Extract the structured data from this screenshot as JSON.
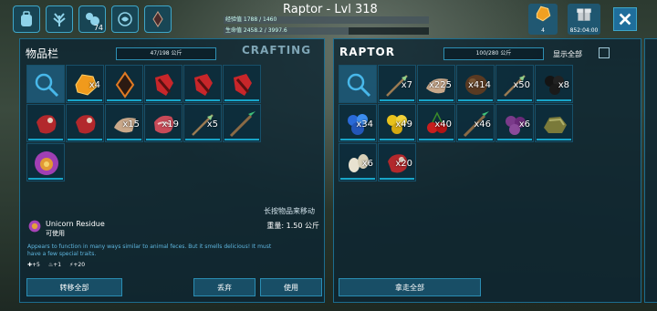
{
  "creature": {
    "title": "Raptor - Lvl 318",
    "xp_bar": "经验值 1788 / 1460",
    "xp_fill": 1.0,
    "hp_bar": "生命值 2458.2 / 3997.6",
    "hp_fill": 0.61
  },
  "top_icons": [
    {
      "name": "backpack-icon"
    },
    {
      "name": "engram-icon"
    },
    {
      "name": "tribe-icon",
      "count": "74"
    },
    {
      "name": "map-icon"
    },
    {
      "name": "crystal-icon"
    }
  ],
  "currency": {
    "amber_count": "4",
    "gift_timer": "852:04:00"
  },
  "colors": {
    "accent": "#1f6e9c",
    "quality_blue": "#18a4c8",
    "desc_text": "#5fb7e0"
  },
  "inventory": {
    "title": "物品栏",
    "weight": "47/198 公斤",
    "crafting_tab": "CRAFTING",
    "slots": [
      {
        "icon": "search-icon",
        "qty": ""
      },
      {
        "icon": "amber-icon",
        "qty": "x4"
      },
      {
        "icon": "element-crystal-icon",
        "qty": ""
      },
      {
        "icon": "red-shard-icon",
        "qty": ""
      },
      {
        "icon": "red-shard-icon",
        "qty": ""
      },
      {
        "icon": "red-shard-icon",
        "qty": ""
      },
      {
        "icon": "raw-meat-icon",
        "qty": ""
      },
      {
        "icon": "raw-meat-icon",
        "qty": ""
      },
      {
        "icon": "hide-icon",
        "qty": "x15"
      },
      {
        "icon": "prime-meat-icon",
        "qty": "x19"
      },
      {
        "icon": "arrow-icon",
        "qty": "x5"
      },
      {
        "icon": "spear-icon",
        "qty": ""
      },
      {
        "icon": "unicorn-residue-icon",
        "qty": ""
      }
    ],
    "hint": "长按物品来移动",
    "item_name": "Unicorn Residue",
    "item_sub": "可使用",
    "item_weight": "重量: 1.50 公斤",
    "item_desc": "Appears to function in many ways similar to animal feces. But it smells delicious! It must have a few special traits.",
    "stats": [
      "+5",
      "+1",
      "+20"
    ],
    "transfer_all": "转移全部",
    "drop": "丢弃",
    "use": "使用"
  },
  "raptor": {
    "title": "RAPTOR",
    "weight": "100/280 公斤",
    "show_all": "显示全部",
    "slots": [
      {
        "icon": "search-icon",
        "qty": ""
      },
      {
        "icon": "arrow-icon",
        "qty": "x7"
      },
      {
        "icon": "hide-icon",
        "qty": "x225"
      },
      {
        "icon": "seed-icon",
        "qty": "x414"
      },
      {
        "icon": "arrow-icon",
        "qty": "x50"
      },
      {
        "icon": "black-berry-icon",
        "qty": "x8"
      },
      {
        "icon": "blue-berry-icon",
        "qty": "x34"
      },
      {
        "icon": "yellow-berry-icon",
        "qty": "x49"
      },
      {
        "icon": "cherry-icon",
        "qty": "x40"
      },
      {
        "icon": "spear-icon",
        "qty": "x46"
      },
      {
        "icon": "purple-berry-icon",
        "qty": "x6"
      },
      {
        "icon": "rock-icon",
        "qty": ""
      },
      {
        "icon": "egg-icon",
        "qty": "x6"
      },
      {
        "icon": "raw-meat-icon",
        "qty": "x20"
      }
    ],
    "take_all": "拿走全部"
  }
}
